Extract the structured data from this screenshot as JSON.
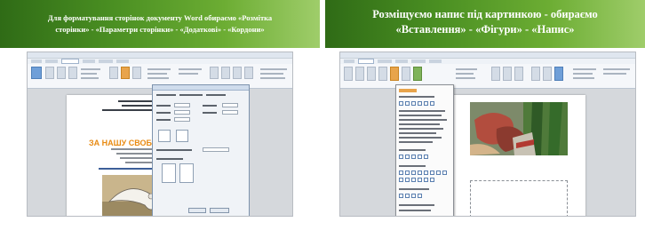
{
  "slides": {
    "left": {
      "banner_lines": [
        "Для форматування сторінок документу Word обираємо «Розмітка",
        "сторінки» - «Параметри сторінки» - «Додаткові» - «Кордони»"
      ],
      "document_heading": "ЗА НАШУ СВОБОДУ"
    },
    "right": {
      "banner_lines": [
        "Розміщуємо напис під картинкою - обираємо",
        "«Вставлення» - «Фігури» - «Напис»"
      ]
    }
  },
  "colors": {
    "banner_dark": "#2f6b16",
    "banner_light": "#9fcd6a",
    "doc_heading": "#e88a12",
    "highlight": "#e8a44b"
  },
  "icons": {
    "dove_image": "dove-drawing",
    "inserted_picture": "painting-hands-flag"
  }
}
